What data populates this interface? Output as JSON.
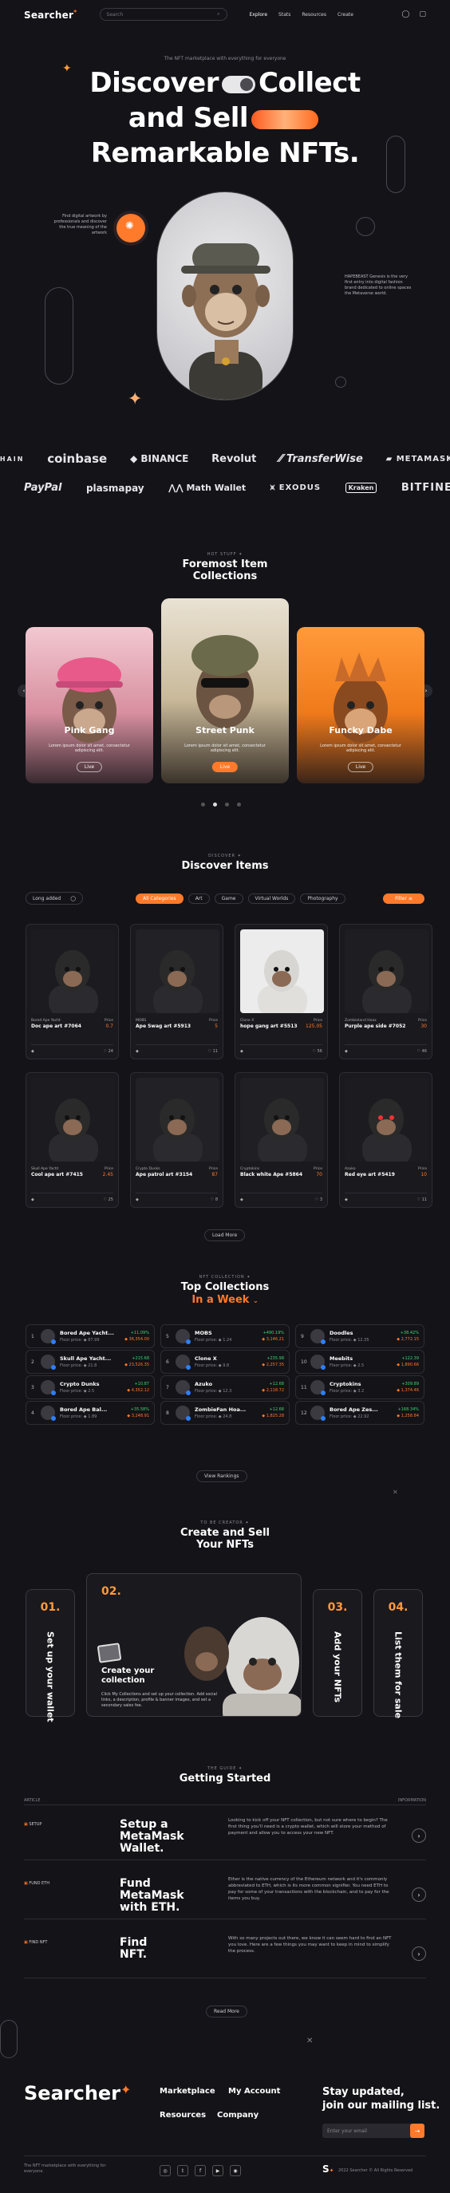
{
  "header": {
    "logo": "Searcher",
    "logo_mark": "*",
    "search_placeholder": "Search",
    "nav": [
      "Explore",
      "Stats",
      "Resources",
      "Create"
    ],
    "icons": [
      "user-icon",
      "wallet-icon"
    ]
  },
  "hero": {
    "tagline": "The NFT marketplace with everything for everyone",
    "line1_a": "Discover",
    "line1_b": "Collect",
    "line2": "and Sell",
    "line3": "Remarkable NFTs.",
    "left_text": "Find digital artwork by professionals and discover the true meaning of the artwork",
    "right_text": "HAPEBEAST Genesis is the very first entry into digital fashion brand dedicated to online spaces the Metaverse world."
  },
  "partners": {
    "row1": [
      "CHAIN",
      "coinbase",
      "BINANCE",
      "Revolut",
      "TransferWise",
      "METAMASK"
    ],
    "row2": [
      "PayPal",
      "plasmapay",
      "Math Wallet",
      "EXODUS",
      "Kraken",
      "BITFINEX"
    ]
  },
  "foremost": {
    "eyebrow": "HOT STUFF ✦",
    "title_1": "Foremost Item",
    "title_2": "Collections",
    "cards": [
      {
        "title": "Pink Gang",
        "desc": "Lorem ipsum dolor sit amet, consectetur adipiscing elit.",
        "button": "Live"
      },
      {
        "title": "Street Punk",
        "desc": "Lorem ipsum dolor sit amet, consectetur adipiscing elit.",
        "button": "Live"
      },
      {
        "title": "Funcky Dabe",
        "desc": "Lorem ipsum dolor sit amet, consectetur adipiscing elit.",
        "button": "Live"
      }
    ]
  },
  "discover": {
    "eyebrow": "DISCOVER ✦",
    "title": "Discover Items",
    "sort": "Long added",
    "filters": [
      "All Categories",
      "Art",
      "Game",
      "Virtual Worlds",
      "Photography"
    ],
    "filter_button": "Filter",
    "load_more": "Load More",
    "items": [
      {
        "collection": "Bored Ape Yacht",
        "name": "Doc ape art #7064",
        "price_label": "Price",
        "price": "0.7",
        "likes": "24"
      },
      {
        "collection": "MOBS",
        "name": "Ape Swag art #5913",
        "price_label": "Price",
        "price": "5",
        "likes": "11"
      },
      {
        "collection": "Clone X",
        "name": "hope gang art #5513",
        "price_label": "Price",
        "price": "125.05",
        "likes": "56"
      },
      {
        "collection": "Zombieland Hoax",
        "name": "Purple ape side #7052",
        "price_label": "Price",
        "price": "30",
        "likes": "46"
      },
      {
        "collection": "Skull Ape Yacht",
        "name": "Cool ape art #7415",
        "price_label": "Price",
        "price": "2.45",
        "likes": "25"
      },
      {
        "collection": "Crypto Dunks",
        "name": "Ape patrol art #3154",
        "price_label": "Price",
        "price": "87",
        "likes": "8"
      },
      {
        "collection": "Cryptokins",
        "name": "Black white Ape #5864",
        "price_label": "Price",
        "price": "70",
        "likes": "3"
      },
      {
        "collection": "Azuko",
        "name": "Red eye art #5419",
        "price_label": "Price",
        "price": "10",
        "likes": "11"
      }
    ]
  },
  "top": {
    "eyebrow": "NFT COLLECTION ✦",
    "title": "Top Collections",
    "subtitle": "In a Week",
    "button": "View Rankings",
    "floor_label": "Floor price:",
    "rows": [
      {
        "n": "1",
        "name": "Bored Ape Yacht...",
        "floor": "87.99",
        "chg": "+11.09%",
        "vol": "36,354.00"
      },
      {
        "n": "2",
        "name": "Skull Ape Yacht...",
        "floor": "21.8",
        "chg": "+215.68",
        "vol": "23,526.35"
      },
      {
        "n": "3",
        "name": "Crypto Dunks",
        "floor": "2.5",
        "chg": "+10.87",
        "vol": "4,352.12"
      },
      {
        "n": "4",
        "name": "Bored Ape Bal...",
        "floor": "1.89",
        "chg": "+35.58%",
        "vol": "3,248.91"
      },
      {
        "n": "5",
        "name": "MOBS",
        "floor": "1.24",
        "chg": "+490.19%",
        "vol": "3,146.21"
      },
      {
        "n": "6",
        "name": "Clone X",
        "floor": "9.8",
        "chg": "+235.98",
        "vol": "2,257.35"
      },
      {
        "n": "7",
        "name": "Azuko",
        "floor": "12.3",
        "chg": "+12.68",
        "vol": "2,118.72"
      },
      {
        "n": "8",
        "name": "ZombieFan Hoa...",
        "floor": "24.8",
        "chg": "+12.68",
        "vol": "1,825.28"
      },
      {
        "n": "9",
        "name": "Doodles",
        "floor": "12.35",
        "chg": "+38.42%",
        "vol": "2,772.15"
      },
      {
        "n": "10",
        "name": "Meebits",
        "floor": "2.5",
        "chg": "+122.39",
        "vol": "1,890.66"
      },
      {
        "n": "11",
        "name": "Cryptokins",
        "floor": "3.2",
        "chg": "+309.89",
        "vol": "1,374.46"
      },
      {
        "n": "12",
        "name": "Bored Ape Zes...",
        "floor": "22.92",
        "chg": "+168.34%",
        "vol": "1,258.84"
      }
    ]
  },
  "create": {
    "eyebrow": "TO BE CREATOR ✦",
    "title_1": "Create and Sell",
    "title_2": "Your NFTs",
    "steps": [
      {
        "num": "01.",
        "label": "Set up your wallet"
      },
      {
        "num": "02.",
        "label": "Create your collection",
        "desc": "Click My Collections and set up your collection. Add social links, a description, profile & banner images, and set a secondary sales fee."
      },
      {
        "num": "03.",
        "label": "Add your NFTs"
      },
      {
        "num": "04.",
        "label": "List them for sale"
      }
    ]
  },
  "getting": {
    "eyebrow": "THE GUIDE ✦",
    "title": "Getting Started",
    "left_tag": "ARTICLE",
    "right_tag": "INFORMATION",
    "rows": [
      {
        "key": "SETUP",
        "title": "Setup a MetaMask Wallet.",
        "text": "Looking to kick off your NFT collection, but not sure where to begin? The first thing you'll need is a crypto wallet, which will store your method of payment and allow you to access your new NFT."
      },
      {
        "key": "FUND ETH",
        "title": "Fund MetaMask with ETH.",
        "text": "Ether is the native currency of the Ethereum network and it's commonly abbreviated to ETH, which is its more common signifier. You need ETH to pay for some of your transactions with the blockchain, and to pay for the items you buy."
      },
      {
        "key": "FIND NFT",
        "title": "Find NFT.",
        "text": "With so many projects out there, we know it can seem hard to find an NFT you love. Here are a few things you may want to keep in mind to simplify the process."
      }
    ],
    "button": "Read More"
  },
  "footer": {
    "logo": "Searcher",
    "links": [
      "Marketplace",
      "My Account",
      "Resources",
      "Company"
    ],
    "news_1": "Stay updated,",
    "news_2": "join our mailing list.",
    "email_placeholder": "Enter your email",
    "tagline": "The NFT marketplace with everything for everyone.",
    "copyright": "2022 Searcher © All Rights Reserved",
    "social": [
      "instagram-icon",
      "twitter-icon",
      "facebook-icon",
      "youtube-icon",
      "discord-icon"
    ]
  },
  "colors": {
    "accent": "#ff7a2a",
    "bg": "#141318",
    "green": "#3bd671"
  }
}
